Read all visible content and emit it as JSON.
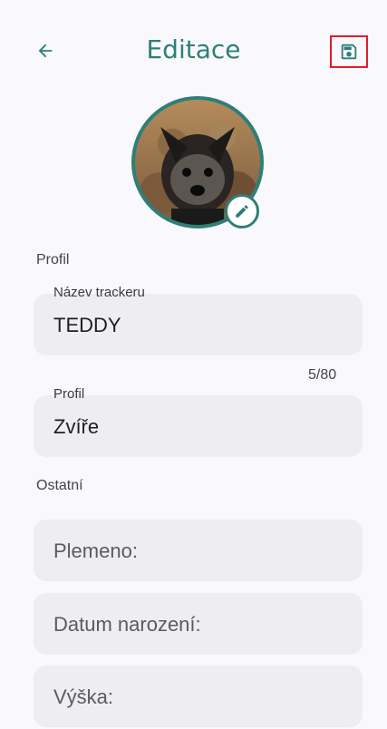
{
  "header": {
    "title": "Editace",
    "back_icon": "arrow-left-icon",
    "save_icon": "save-icon"
  },
  "avatar": {
    "edit_icon": "pencil-icon"
  },
  "section_profile": "Profil",
  "fields": {
    "tracker_name": {
      "label": "Název trackeru",
      "value": "TEDDY",
      "counter": "5/80"
    },
    "profile": {
      "label": "Profil",
      "value": "Zvíře"
    }
  },
  "section_other": "Ostatní",
  "other_fields": [
    {
      "placeholder": "Plemeno:"
    },
    {
      "placeholder": "Datum narození:"
    },
    {
      "placeholder": "Výška:"
    }
  ],
  "colors": {
    "accent": "#2f7f78",
    "highlight": "#e01c2a"
  }
}
